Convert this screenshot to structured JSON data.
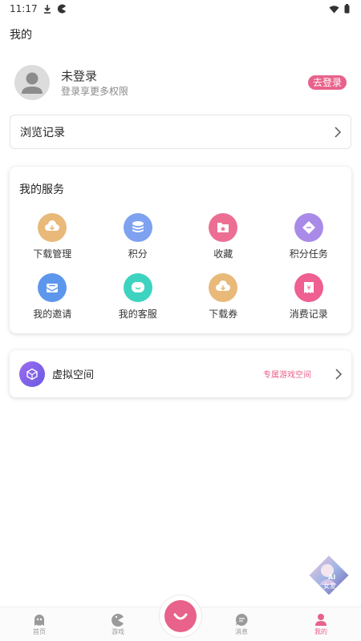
{
  "status_bar": {
    "time": "11:17"
  },
  "page": {
    "title": "我的"
  },
  "profile": {
    "name": "未登录",
    "subtitle": "登录享更多权限",
    "login_label": "去登录"
  },
  "history": {
    "label": "浏览记录"
  },
  "services": {
    "title": "我的服务",
    "items": [
      {
        "label": "下载管理",
        "icon": "cloud-download-icon",
        "color": "#e9b97a"
      },
      {
        "label": "积分",
        "icon": "coin-stack-icon",
        "color": "#7ea1f0"
      },
      {
        "label": "收藏",
        "icon": "star-box-icon",
        "color": "#ec6f93"
      },
      {
        "label": "积分任务",
        "icon": "diamond-icon",
        "color": "#a98ae8"
      },
      {
        "label": "我的邀请",
        "icon": "mail-icon",
        "color": "#5d97ec"
      },
      {
        "label": "我的客服",
        "icon": "chat-icon",
        "color": "#3ed3c0"
      },
      {
        "label": "下载券",
        "icon": "cloud-download-icon",
        "color": "#e9b97a"
      },
      {
        "label": "消费记录",
        "icon": "receipt-icon",
        "color": "#ef5f91"
      }
    ]
  },
  "virtual_space": {
    "label": "虚拟空间",
    "tag": "专属游戏空间"
  },
  "float_badge": {
    "text_top": "AI",
    "text_bottom": "女友"
  },
  "tabbar": {
    "accent": "#e8628b",
    "tabs": [
      {
        "label": "首页",
        "icon": "ghost-icon",
        "active": false
      },
      {
        "label": "游戏",
        "icon": "gamepad-icon",
        "active": false
      },
      {
        "label": "消息",
        "icon": "message-icon",
        "active": false
      },
      {
        "label": "我的",
        "icon": "person-icon",
        "active": true
      }
    ]
  }
}
